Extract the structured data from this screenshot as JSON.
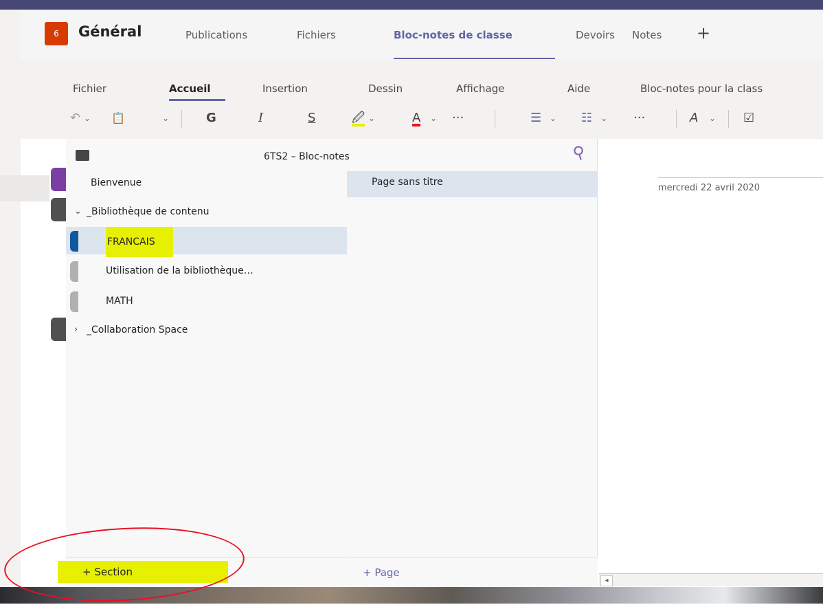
{
  "teams": {
    "avatar": "6",
    "channel": "Général",
    "tabs": [
      "Publications",
      "Fichiers",
      "Bloc-notes de classe",
      "Devoirs",
      "Notes"
    ],
    "add_tab": "+"
  },
  "ribbon": {
    "tabs": [
      "Fichier",
      "Accueil",
      "Insertion",
      "Dessin",
      "Affichage",
      "Aide",
      "Bloc-notes pour la class"
    ],
    "tools": {
      "undo": "↶",
      "clipboard": "📋",
      "bold": "G",
      "italic": "I",
      "strike": "S",
      "highlight": "🖉",
      "fontcolor": "A",
      "more": "···",
      "bullets": "☰",
      "numbering": "☷",
      "more2": "···",
      "style": "A",
      "tag": "☑"
    }
  },
  "notebook": {
    "title": "6TS2 – Bloc-notes",
    "sections": [
      {
        "label": "Bienvenue",
        "type": "item"
      },
      {
        "label": "_Bibliothèque de contenu",
        "type": "group",
        "expanded": true
      },
      {
        "label": "FRANCAIS",
        "type": "child",
        "selected": true
      },
      {
        "label": "Utilisation de la bibliothèque…",
        "type": "child"
      },
      {
        "label": "MATH",
        "type": "child"
      },
      {
        "label": "_Collaboration Space",
        "type": "group",
        "expanded": false
      }
    ],
    "pages": [
      {
        "label": "Page sans titre"
      }
    ],
    "add_section": "+ Section",
    "add_page": "+ Page"
  },
  "canvas": {
    "date": "mercredi 22 avril 2020"
  },
  "colors": {
    "teams_purple": "#6264a7",
    "team_avatar": "#d83b01",
    "highlight_yellow": "#e6f000",
    "annotation_red": "#e81123"
  }
}
